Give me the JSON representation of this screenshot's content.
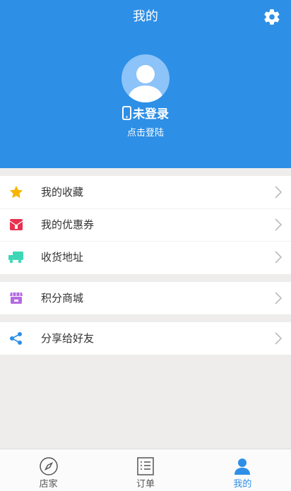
{
  "header": {
    "title": "我的",
    "settings_icon": "gear-icon",
    "login_text": "未登录",
    "login_sub": "点击登陆",
    "bg_color": "#2e8fe6"
  },
  "menu": {
    "group1": [
      {
        "label": "我的收藏",
        "icon": "star-icon"
      },
      {
        "label": "我的优惠券",
        "icon": "coupon-icon"
      },
      {
        "label": "收货地址",
        "icon": "truck-icon"
      }
    ],
    "group2": [
      {
        "label": "积分商城",
        "icon": "store-icon"
      }
    ],
    "group3": [
      {
        "label": "分享给好友",
        "icon": "share-icon"
      }
    ]
  },
  "tabs": [
    {
      "label": "店家",
      "icon": "compass-icon",
      "active": false
    },
    {
      "label": "订单",
      "icon": "list-icon",
      "active": false
    },
    {
      "label": "我的",
      "icon": "user-icon",
      "active": true
    }
  ]
}
